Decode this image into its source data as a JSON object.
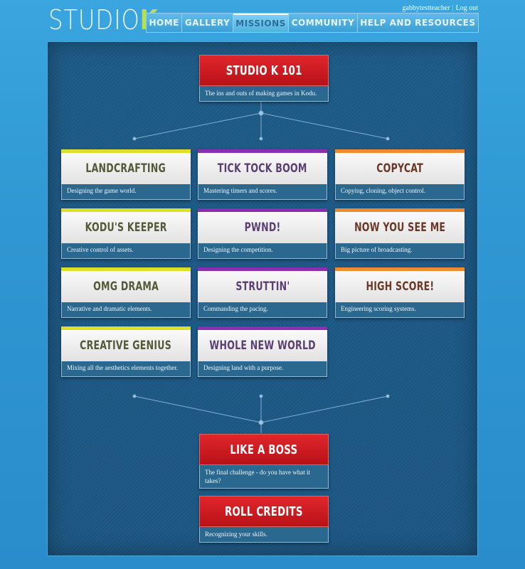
{
  "brand": {
    "logo_main": "STUDIO",
    "logo_accent": "K"
  },
  "user": {
    "username": "gabbytestteacher",
    "separator": "|",
    "logout": "Log out"
  },
  "nav": [
    {
      "label": "HOME"
    },
    {
      "label": "GALLERY"
    },
    {
      "label": "MISSIONS",
      "active": true
    },
    {
      "label": "COMMUNITY"
    },
    {
      "label": "HELP AND RESOURCES"
    }
  ],
  "missions": {
    "intro": {
      "title": "STUDIO K 101",
      "desc": "The ins and outs of making games in Kodu."
    },
    "grid": [
      {
        "title": "LANDCRAFTING",
        "desc": "Designing the game world.",
        "color": "yellow"
      },
      {
        "title": "TICK TOCK BOOM",
        "desc": "Mastering timers and scores.",
        "color": "purple"
      },
      {
        "title": "COPYCAT",
        "desc": "Copying, cloning, object control.",
        "color": "orange"
      },
      {
        "title": "KODU'S KEEPER",
        "desc": "Creative control of assets.",
        "color": "yellow"
      },
      {
        "title": "PWND!",
        "desc": "Designing the competition.",
        "color": "purple"
      },
      {
        "title": "NOW YOU SEE ME",
        "desc": "Big picture of broadcasting.",
        "color": "orange"
      },
      {
        "title": "OMG DRAMA",
        "desc": "Narrative and dramatic elements.",
        "color": "yellow"
      },
      {
        "title": "STRUTTIN'",
        "desc": "Commanding the pacing.",
        "color": "purple"
      },
      {
        "title": "HIGH SCORE!",
        "desc": "Engineering scoring systems.",
        "color": "orange"
      },
      {
        "title": "CREATIVE GENIUS",
        "desc": "Mixing all the aesthetics elements together.",
        "color": "yellow"
      },
      {
        "title": "WHOLE NEW WORLD",
        "desc": "Designing land with a purpose.",
        "color": "purple"
      }
    ],
    "final": {
      "title": "LIKE A BOSS",
      "desc": "The final challenge - do you have what it takes?"
    },
    "credits": {
      "title": "ROLL CREDITS",
      "desc": "Recognizing your skills."
    }
  },
  "colors": {
    "yellow": "#dce02a",
    "purple": "#8a2fb0",
    "orange": "#f08a30",
    "red": "#c8171c"
  }
}
